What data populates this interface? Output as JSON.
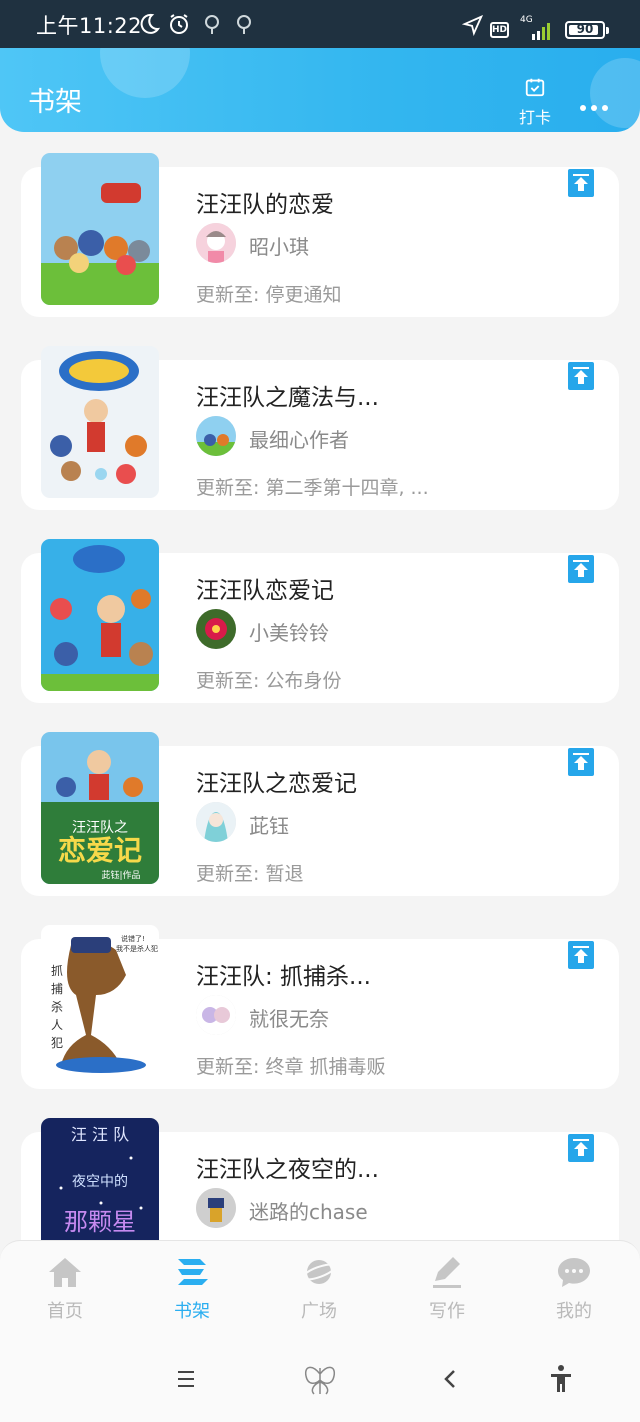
{
  "status_bar": {
    "time": "上午11:22",
    "network": "4G",
    "hd": "HD",
    "battery": "90"
  },
  "header": {
    "title": "书架",
    "checkin_label": "打卡"
  },
  "books": [
    {
      "title": "汪汪队的恋爱",
      "author": "昭小琪",
      "update": "更新至: 停更通知"
    },
    {
      "title": "汪汪队之魔法与...",
      "author": "最细心作者",
      "update": "更新至: 第二季第十四章, ..."
    },
    {
      "title": "汪汪队恋爱记",
      "author": "小美铃铃",
      "update": "更新至: 公布身份"
    },
    {
      "title": "汪汪队之恋爱记",
      "author": "茈钰",
      "update": "更新至: 暂退",
      "cover_text": "汪汪队之 恋爱记 茈钰|作品"
    },
    {
      "title": "汪汪队: 抓捕杀...",
      "author": "就很无奈",
      "update": "更新至: 终章 抓捕毒贩",
      "cover_text": "抓捕杀人犯 说错了! 我不是杀人犯"
    },
    {
      "title": "汪汪队之夜空的...",
      "author": "迷路的chase",
      "update": "",
      "cover_text": "汪汪队 夜空中的 那颗星"
    }
  ],
  "bottom_nav": [
    {
      "label": "首页",
      "icon": "home-icon",
      "active": false
    },
    {
      "label": "书架",
      "icon": "bookshelf-icon",
      "active": true
    },
    {
      "label": "广场",
      "icon": "planet-icon",
      "active": false
    },
    {
      "label": "写作",
      "icon": "pen-icon",
      "active": false
    },
    {
      "label": "我的",
      "icon": "chat-bubble-icon",
      "active": false
    }
  ],
  "colors": {
    "accent": "#2aaef0",
    "header_start": "#4fc6f6",
    "header_end": "#29aeee",
    "status_bar": "#1f3140"
  }
}
